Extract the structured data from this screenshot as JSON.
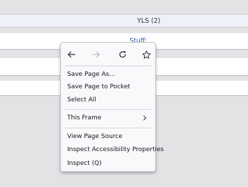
{
  "header": {
    "title": "YLS (2)"
  },
  "content": {
    "stuff_label": "Stuff:",
    "row3_fragment": "."
  },
  "context_menu": {
    "nav_icons": [
      "back-arrow-icon",
      "forward-arrow-icon",
      "reload-icon",
      "bookmark-star-icon"
    ],
    "items": [
      {
        "label": "Save Page As…"
      },
      {
        "label": "Save Page to Pocket"
      },
      {
        "label": "Select All"
      },
      {
        "label": "This Frame"
      },
      {
        "label": "View Page Source"
      },
      {
        "label": "Inspect Accessibility Properties"
      },
      {
        "label": "Inspect (Q)"
      }
    ]
  },
  "colors": {
    "page_bg": "#e3e3e6",
    "menu_bg": "#f9f9fb",
    "link": "#2a5ea8"
  }
}
